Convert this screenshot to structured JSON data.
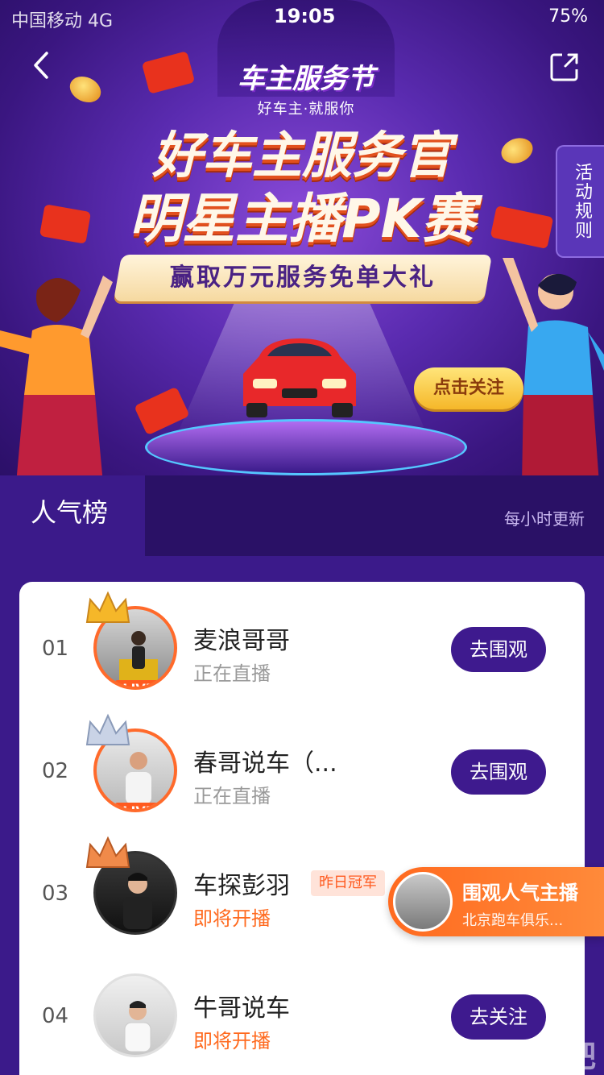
{
  "status_bar": {
    "carrier": "中国移动  4G",
    "time": "19:05",
    "battery": "75%"
  },
  "hero": {
    "logo_main": "车主服务节",
    "logo_sub": "好车主·就服你",
    "headline_1": "好车主服务官",
    "headline_2": "明星主播PK赛",
    "ribbon": "赢取万元服务免单大礼",
    "side_rules": "活动规则",
    "follow_button": "点击关注",
    "icons": [
      "back-icon",
      "share-icon"
    ]
  },
  "board": {
    "tab_label": "人气榜",
    "update_note": "每小时更新"
  },
  "ranking": [
    {
      "rank": "01",
      "name": "麦浪哥哥",
      "status": "正在直播",
      "status_type": "live",
      "live_badge": "LIVE",
      "action": "去围观",
      "crown": "gold"
    },
    {
      "rank": "02",
      "name": "春哥说车（...",
      "status": "正在直播",
      "status_type": "live",
      "live_badge": "LIVE",
      "action": "去围观",
      "crown": "silver"
    },
    {
      "rank": "03",
      "name": "车探彭羽",
      "status": "即将开播",
      "status_type": "soon",
      "badge": "昨日冠军",
      "crown": "bronze"
    },
    {
      "rank": "04",
      "name": "牛哥说车",
      "status": "即将开播",
      "status_type": "soon",
      "action": "去关注"
    }
  ],
  "popup": {
    "title": "围观人气主播",
    "subtitle": "北京跑车俱乐..."
  },
  "watermark": "氪服网吧",
  "colors": {
    "primary": "#3e1a8e",
    "accent": "#ff6a1f",
    "gold": "#f5b729"
  }
}
